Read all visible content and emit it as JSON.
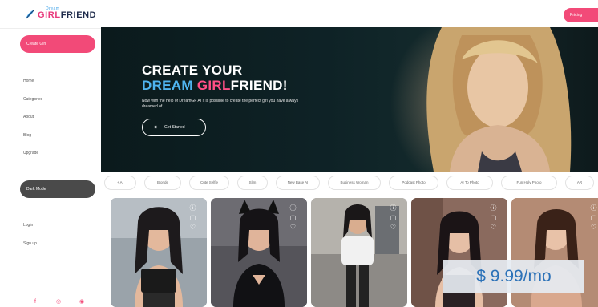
{
  "header": {
    "logo_small": "Dream",
    "logo_word_1": "GIRL",
    "logo_word_2": "FRIEND",
    "right_button": "Pricing"
  },
  "sidebar": {
    "create_button": "Create Girl",
    "nav": [
      "Home",
      "Categories",
      "About",
      "Blog",
      "Upgrade"
    ],
    "dark_mode_button": "Dark Mode",
    "auth": [
      "Login",
      "Sign up"
    ],
    "social_icons": [
      "facebook-icon",
      "instagram-icon",
      "reddit-icon"
    ]
  },
  "hero": {
    "title_line1": "CREATE YOUR",
    "title_dream": "DREAM ",
    "title_girl": "GIRL",
    "title_friend": "FRIEND!",
    "subtitle": "Now with the help of DreamGF AI it is possible to create the perfect girl you have always dreamed of",
    "cta": "Get Started"
  },
  "categories": [
    "+ AI",
    "Blonde",
    "Cute Selfie",
    "Slim",
    "New Base AI",
    "Business Woman",
    "Podcast Photo",
    "AI To Photo",
    "Fun Holy Photo",
    "AR"
  ],
  "cards_count": 5,
  "price_badge": "$ 9.99/mo",
  "colors": {
    "accent_pink": "#f24a78",
    "accent_blue": "#4fb4f0",
    "dark_button": "#4a4a4a"
  }
}
